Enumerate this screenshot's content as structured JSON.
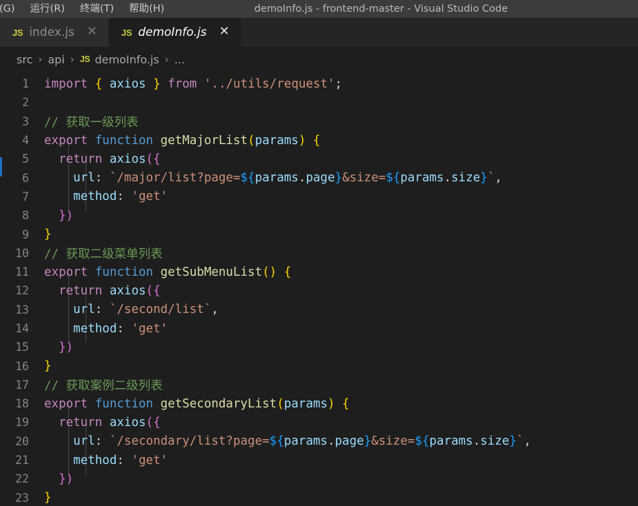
{
  "window": {
    "title": "demoInfo.js - frontend-master - Visual Studio Code",
    "menu": [
      {
        "label": "(G)"
      },
      {
        "label": "运行(R)"
      },
      {
        "label": "终端(T)"
      },
      {
        "label": "帮助(H)"
      }
    ]
  },
  "tabs": [
    {
      "icon": "js-file-icon",
      "icon_label": "JS",
      "label": "index.js",
      "close": "✕",
      "active": false
    },
    {
      "icon": "js-file-icon",
      "icon_label": "JS",
      "label": "demoInfo.js",
      "close": "✕",
      "active": true
    }
  ],
  "breadcrumb": {
    "separator": "›",
    "items": [
      {
        "type": "folder",
        "label": "src"
      },
      {
        "type": "folder",
        "label": "api"
      },
      {
        "type": "file",
        "icon_label": "JS",
        "label": "demoInfo.js"
      },
      {
        "type": "symbol",
        "label": "..."
      }
    ]
  },
  "editor": {
    "filename": "demoInfo.js",
    "language": "javascript",
    "accent_color": "#1f6fc4",
    "background": "#1e1e1e",
    "line_numbers": [
      "1",
      "2",
      "3",
      "4",
      "5",
      "6",
      "7",
      "8",
      "9",
      "10",
      "11",
      "12",
      "13",
      "14",
      "15",
      "16",
      "17",
      "18",
      "19",
      "20",
      "21",
      "22",
      "23"
    ],
    "lines": [
      {
        "n": "1",
        "text": "import { axios } from '../utils/request';"
      },
      {
        "n": "2",
        "text": ""
      },
      {
        "n": "3",
        "text": "// 获取一级列表"
      },
      {
        "n": "4",
        "text": "export function getMajorList(params) {"
      },
      {
        "n": "5",
        "text": "  return axios({"
      },
      {
        "n": "6",
        "text": "    url: `/major/list?page=${params.page}&size=${params.size}`,"
      },
      {
        "n": "7",
        "text": "    method: 'get'"
      },
      {
        "n": "8",
        "text": "  })"
      },
      {
        "n": "9",
        "text": "}"
      },
      {
        "n": "10",
        "text": "// 获取二级菜单列表"
      },
      {
        "n": "11",
        "text": "export function getSubMenuList() {"
      },
      {
        "n": "12",
        "text": "  return axios({"
      },
      {
        "n": "13",
        "text": "    url: `/second/list`,"
      },
      {
        "n": "14",
        "text": "    method: 'get'"
      },
      {
        "n": "15",
        "text": "  })"
      },
      {
        "n": "16",
        "text": "}"
      },
      {
        "n": "17",
        "text": "// 获取案例二级列表"
      },
      {
        "n": "18",
        "text": "export function getSecondaryList(params) {"
      },
      {
        "n": "19",
        "text": "  return axios({"
      },
      {
        "n": "20",
        "text": "    url: `/secondary/list?page=${params.page}&size=${params.size}`,"
      },
      {
        "n": "21",
        "text": "    method: 'get'"
      },
      {
        "n": "22",
        "text": "  })"
      },
      {
        "n": "23",
        "text": "}"
      }
    ],
    "tokens": {
      "kw_import": "import",
      "kw_export": "export",
      "kw_from": "from",
      "kw_function": "function",
      "kw_return": "return",
      "id_axios": "axios",
      "id_params": "params",
      "id_url": "url",
      "id_method": "method",
      "id_page": "page",
      "id_size": "size",
      "fn_getMajorList": "getMajorList",
      "fn_getSubMenuList": "getSubMenuList",
      "fn_getSecondaryList": "getSecondaryList",
      "str_request_path": "'../utils/request'",
      "str_get": "'get'",
      "tpl_major": "`/major/list?page=",
      "tpl_major_mid": "&size=",
      "tpl_second": "`/second/list`",
      "tpl_secondary": "`/secondary/list?page=",
      "cmt_1": "// 获取一级列表",
      "cmt_2": "// 获取二级菜单列表",
      "cmt_3": "// 获取案例二级列表"
    },
    "colors": {
      "keyword": "#C586C0",
      "keyword_blue": "#569CD6",
      "identifier": "#9CDCFE",
      "function_name": "#DCDCAA",
      "string": "#CE9178",
      "comment": "#6A9955",
      "plain": "#D4D4D4",
      "brace_yellow": "#FFD700",
      "brace_purple": "#DA70D6",
      "brace_blue": "#179FFF",
      "line_number": "#868686"
    }
  }
}
